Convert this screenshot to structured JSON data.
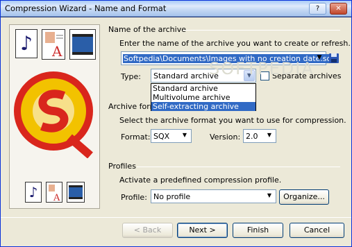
{
  "window": {
    "title": "Compression Wizard - Name and Format",
    "help_btn": "?",
    "close_btn": "✕"
  },
  "name_group": {
    "title": "Name of the archive",
    "instruction": "Enter the name of the archive you want to create or refresh.",
    "path_value": "Softpedia\\Documents\\Images with no creation date.sqx",
    "type_label": "Type:",
    "type_value": "Standard archive",
    "type_options": [
      "Standard archive",
      "Multivolume archive",
      "Self-extracting archive"
    ],
    "separate_label": "Separate archives"
  },
  "format_group": {
    "title": "Archive format",
    "instruction": "Select the archive format you want to use for compression.",
    "format_label": "Format:",
    "format_value": "SQX",
    "version_label": "Version:",
    "version_value": "2.0"
  },
  "profiles_group": {
    "title": "Profiles",
    "instruction": "Activate a predefined compression profile.",
    "profile_label": "Profile:",
    "profile_value": "No profile",
    "organize_label": "Organize..."
  },
  "buttons": {
    "back": "< Back",
    "next": "Next >",
    "finish": "Finish",
    "cancel": "Cancel"
  },
  "watermark": "SOFTPEDIA",
  "colors": {
    "selection": "#316ac5",
    "dialog_bg": "#ece9d8",
    "logo_yellow": "#f2c200",
    "logo_red": "#d9261c"
  }
}
